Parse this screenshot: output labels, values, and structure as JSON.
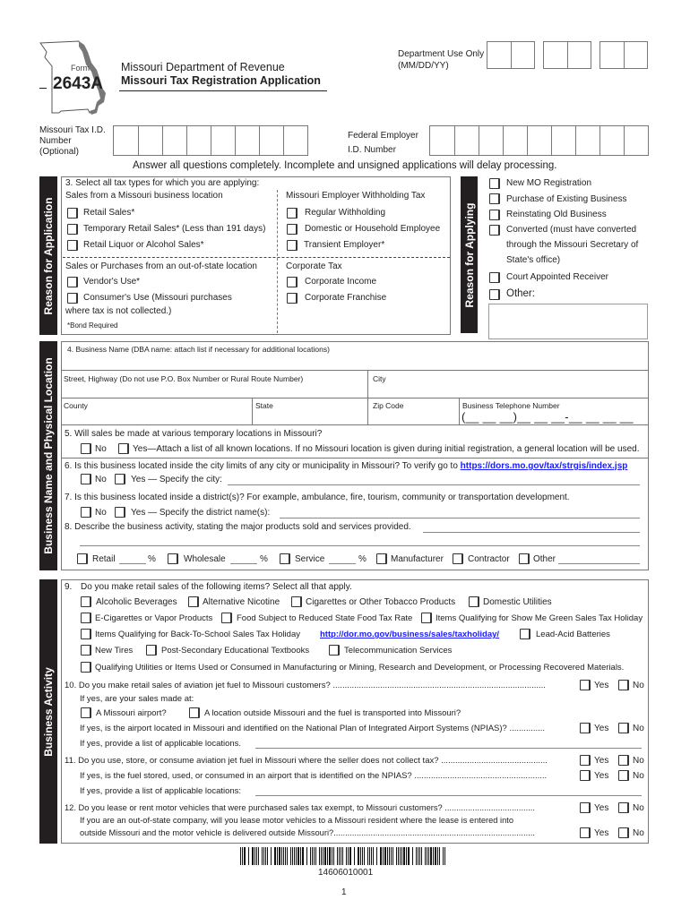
{
  "header": {
    "form_label": "Form",
    "form_number": "2643A",
    "department": "Missouri Department of Revenue",
    "title": "Missouri Tax Registration Application",
    "dept_use_label": "Department Use Only",
    "dept_use_format": "(MM/DD/YY)"
  },
  "ids": {
    "mo_tax_id_label_1": "Missouri Tax I.D.",
    "mo_tax_id_label_2": "Number",
    "mo_tax_id_label_3": "(Optional)",
    "fein_label_1": "Federal Employer",
    "fein_label_2": "I.D. Number"
  },
  "instructions": "Answer all questions completely.  Incomplete and unsigned applications will delay processing.",
  "section_labels": {
    "reason_application": "Reason for Application",
    "reason_applying": "Reason for Applying",
    "business_location": "Business Name and Physical Location",
    "business_activity": "Business Activity"
  },
  "q3": {
    "title": "3. Select all tax types for which you are applying:",
    "mo_location_heading": "Sales from a Missouri business location",
    "mo_location_items": [
      "Retail Sales*",
      "Temporary Retail Sales* (Less than 191 days)",
      "Retail Liquor or Alcohol Sales*"
    ],
    "withholding_heading": "Missouri Employer Withholding Tax",
    "withholding_items": [
      "Regular Withholding",
      "Domestic or Household Employee",
      "Transient Employer*"
    ],
    "out_of_state_heading": "Sales or Purchases from an out-of-state location",
    "out_of_state_items": [
      "Vendor's Use*",
      "Consumer's Use (Missouri purchases"
    ],
    "out_of_state_cont": "where tax is not collected.)",
    "corporate_heading": "Corporate Tax",
    "corporate_items": [
      "Corporate Income",
      "Corporate Franchise"
    ],
    "bond_note": "*Bond Required"
  },
  "reasons": {
    "items": [
      "New MO Registration",
      "Purchase of Existing Business",
      "Reinstating Old Business",
      "Converted (must have converted"
    ],
    "converted_cont_1": "through the Missouri Secretary of",
    "converted_cont_2": "State's office)",
    "court": "Court Appointed Receiver",
    "other": "Other:",
    "other_value": ""
  },
  "q4": {
    "business_name": "4. Business Name (DBA name: attach list if necessary for additional locations)",
    "street": "Street, Highway (Do not use P.O. Box Number or Rural Route Number)",
    "city": "City",
    "county": "County",
    "state": "State",
    "zip": "Zip Code",
    "phone": "Business Telephone Number",
    "phone_template": "(__ __ __)__ __ __-__ __ __ __"
  },
  "q5": {
    "text": "5. Will sales be made at various temporary locations in Missouri?",
    "no": "No",
    "yes": "Yes—Attach a list of all known locations. If no Missouri location is given during initial registration, a general location will be used."
  },
  "q6": {
    "text": "6. Is this business located inside the city limits of any city or municipality in Missouri?  To verify go to",
    "link": "https://dors.mo.gov/tax/strgis/index.jsp",
    "no": "No",
    "yes": "Yes — Specify the city:"
  },
  "q7": {
    "text": "7. Is this business located inside a district(s)?  For example, ambulance, fire, tourism, community or transportation development.",
    "no": "No",
    "yes": "Yes — Specify the district name(s):"
  },
  "q8": {
    "text": "8. Describe the business activity, stating the major products sold and services provided.",
    "retail": "Retail",
    "wholesale": "Wholesale",
    "service": "Service",
    "percent": "%",
    "manufacturer": "Manufacturer",
    "contractor": "Contractor",
    "other": "Other"
  },
  "q9": {
    "num": "9.",
    "text": "Do you make retail sales of the following items?  Select all that apply.",
    "row1": [
      "Alcoholic Beverages",
      "Alternative Nicotine",
      "Cigarettes or Other Tobacco Products",
      "Domestic Utilities"
    ],
    "row2": [
      "E-Cigarettes or Vapor Products",
      "Food Subject to Reduced State Food Tax Rate",
      "Items Qualifying for Show Me Green Sales Tax Holiday"
    ],
    "row3_item": "Items Qualifying for Back-To-School Sales Tax Holiday",
    "row3_link": "http://dor.mo.gov/business/sales/taxholiday/",
    "row3_item2": "Lead-Acid Batteries",
    "row4": [
      "New Tires",
      "Post-Secondary Educational Textbooks",
      "Telecommunication Services"
    ],
    "row5": "Qualifying Utilities or Items Used or Consumed in Manufacturing or Mining, Research and Development, or Processing Recovered Materials."
  },
  "q10": {
    "text": "10. Do you make retail sales of aviation jet fuel to Missouri customers? ..........................................................................................",
    "sub1": "If yes, are your sales made at:",
    "opt1": "A Missouri airport?",
    "opt2": "A location outside Missouri and the fuel is transported into Missouri?",
    "sub2": "If yes, is the airport located in Missouri and identified on the National Plan of Integrated Airport Systems (NPIAS)? ...............",
    "sub3": "If yes, provide a list of applicable locations."
  },
  "q11": {
    "text": "11. Do you use, store, or consume aviation jet fuel in Missouri where the seller does not collect tax? .............................................",
    "sub1": "If yes, is the fuel stored, used, or consumed in an airport that is identified on the NPIAS? ........................................................",
    "sub2": "If yes, provide a list of applicable locations:"
  },
  "q12": {
    "text": "12. Do you lease or rent motor vehicles that were purchased sales tax exempt, to Missouri customers? .......................................",
    "sub1": "If you are an out-of-state company, will you lease motor vehicles to a Missouri resident where the lease is entered into",
    "sub2": "outside Missouri and the motor vehicle is delivered outside Missouri?......................................................................................."
  },
  "yes_label": "Yes",
  "no_label": "No",
  "footer": {
    "barcode_number": "14606010001",
    "page_number": "1"
  }
}
